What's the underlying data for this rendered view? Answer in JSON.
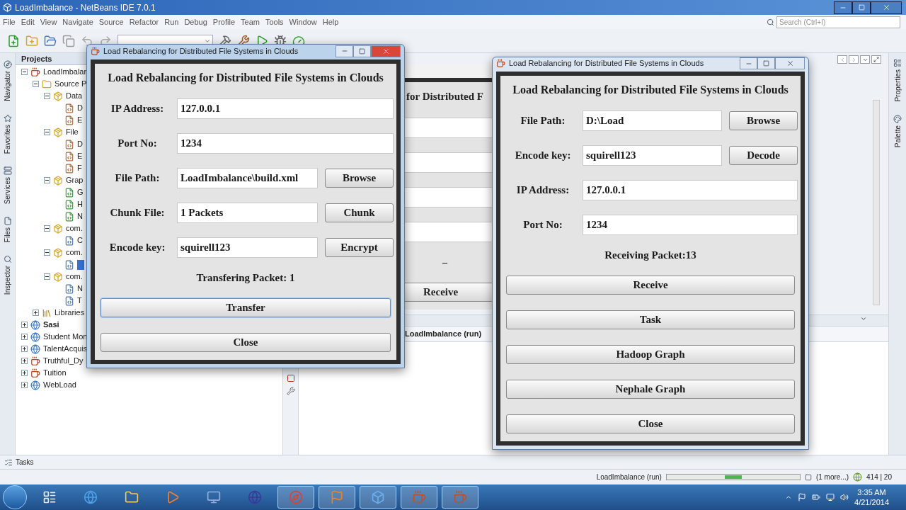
{
  "ide": {
    "title": "LoadImbalance - NetBeans IDE 7.0.1",
    "menu": [
      "File",
      "Edit",
      "View",
      "Navigate",
      "Source",
      "Refactor",
      "Run",
      "Debug",
      "Profile",
      "Team",
      "Tools",
      "Window",
      "Help"
    ],
    "search": {
      "placeholder": "Search (Ctrl+I)"
    },
    "left_tabs": [
      "Navigator",
      "Favorites",
      "Services",
      "Files",
      "Inspector"
    ],
    "right_tabs": [
      "Properties",
      "Palette"
    ],
    "projects": {
      "title": "Projects",
      "tree": [
        {
          "label": "LoadImbalan",
          "kind": "project",
          "expanded": true,
          "children": [
            {
              "label": "Source P",
              "kind": "sources",
              "expanded": true,
              "children": [
                {
                  "label": "Data",
                  "kind": "package",
                  "expanded": true,
                  "children": [
                    {
                      "label": "D",
                      "kind": "form"
                    },
                    {
                      "label": "E",
                      "kind": "form"
                    }
                  ]
                },
                {
                  "label": "File",
                  "kind": "package",
                  "expanded": true,
                  "children": [
                    {
                      "label": "D",
                      "kind": "form"
                    },
                    {
                      "label": "E",
                      "kind": "form"
                    },
                    {
                      "label": "F",
                      "kind": "form"
                    }
                  ]
                },
                {
                  "label": "Grap",
                  "kind": "package",
                  "expanded": true,
                  "children": [
                    {
                      "label": "G",
                      "kind": "runform"
                    },
                    {
                      "label": "H",
                      "kind": "runform"
                    },
                    {
                      "label": "N",
                      "kind": "runform"
                    }
                  ]
                },
                {
                  "label": "com.",
                  "kind": "package",
                  "expanded": true,
                  "children": [
                    {
                      "label": "C",
                      "kind": "class"
                    }
                  ]
                },
                {
                  "label": "com.",
                  "kind": "package",
                  "expanded": true,
                  "children": [
                    {
                      "kind": "class",
                      "selected": true
                    }
                  ]
                },
                {
                  "label": "com.",
                  "kind": "package",
                  "expanded": true,
                  "children": [
                    {
                      "label": "N",
                      "kind": "class"
                    },
                    {
                      "label": "T",
                      "kind": "class"
                    }
                  ]
                }
              ]
            },
            {
              "label": "Libraries",
              "kind": "library",
              "expanded": false
            }
          ]
        },
        {
          "label": "Sasi",
          "kind": "web",
          "expanded": false,
          "main": true
        },
        {
          "label": "Student Mon",
          "kind": "web",
          "expanded": false
        },
        {
          "label": "TalentAcquis",
          "kind": "web",
          "expanded": false
        },
        {
          "label": "Truthful_Dy",
          "kind": "project",
          "expanded": false
        },
        {
          "label": "Tuition",
          "kind": "project",
          "expanded": false
        },
        {
          "label": "WebLoad",
          "kind": "web",
          "expanded": false
        }
      ]
    },
    "background_window": {
      "heading": "for Distributed F",
      "label": "–",
      "button": "Receive"
    },
    "output": {
      "tab": "LoadImbalance (run)"
    },
    "tasks": "Tasks",
    "status_bar": {
      "task": "LoadImbalance (run)",
      "progress": {
        "level": 0.5
      },
      "more": "(1 more...)",
      "position": "414 | 20"
    }
  },
  "dialogs": [
    {
      "title": "Load Rebalancing for Distributed File Systems in Clouds",
      "active": true,
      "heading": "Load Rebalancing for Distributed File Systems in Clouds",
      "rows": [
        {
          "label": "IP Address:",
          "value": "127.0.0.1"
        },
        {
          "label": "Port No:",
          "value": "1234"
        },
        {
          "label": "File Path:",
          "value": "LoadImbalance\\build.xml",
          "button": "Browse"
        },
        {
          "label": "Chunk File:",
          "value": "1 Packets",
          "button": "Chunk"
        },
        {
          "label": "Encode key:",
          "value": "squirell123",
          "button": "Encrypt"
        }
      ],
      "status": "Transfering Packet: 1",
      "buttons": [
        {
          "label": "Transfer",
          "focused": true
        },
        {
          "label": "Close",
          "focused": false
        }
      ]
    },
    {
      "title": "Load Rebalancing for Distributed File Systems in Clouds",
      "active": false,
      "heading": "Load Rebalancing for Distributed File Systems in Clouds",
      "rows": [
        {
          "label": "File Path:",
          "value": "D:\\Load",
          "button": "Browse"
        },
        {
          "label": "Encode key:",
          "value": "squirell123",
          "button": "Decode"
        },
        {
          "label": "IP Address:",
          "value": "127.0.0.1"
        },
        {
          "label": "Port No:",
          "value": "1234"
        }
      ],
      "status": "Receiving Packet:13",
      "buttons": [
        {
          "label": "Receive",
          "focused": false
        },
        {
          "label": "Task",
          "focused": false
        },
        {
          "label": "Hadoop Graph",
          "focused": false
        },
        {
          "label": "Nephale Graph",
          "focused": false
        },
        {
          "label": "Close",
          "focused": false
        }
      ]
    }
  ],
  "taskbar": {
    "time": "3:35 AM",
    "date": "4/21/2014"
  }
}
